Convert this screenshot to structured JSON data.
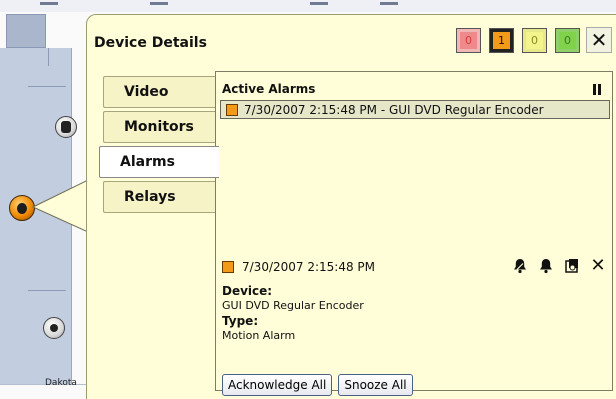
{
  "map": {
    "label": "Dakota"
  },
  "panel": {
    "title": "Device Details",
    "status_counts": [
      {
        "name": "red",
        "value": "0",
        "outer": "#f0b7b7",
        "inner": "#f08a8a",
        "text": "#d04040"
      },
      {
        "name": "orange",
        "value": "1",
        "outer": "#222222",
        "inner": "#f39a18",
        "text": "#111111"
      },
      {
        "name": "yellow",
        "value": "0",
        "outer": "#e6e88a",
        "inner": "#f3f58a",
        "text": "#8a8a20"
      },
      {
        "name": "green",
        "value": "0",
        "outer": "#8fd06a",
        "inner": "#7fd24a",
        "text": "#3a7a20"
      }
    ],
    "close_label": "✕"
  },
  "tabs": [
    {
      "label": "Video",
      "active": false
    },
    {
      "label": "Monitors",
      "active": false
    },
    {
      "label": "Alarms",
      "active": true
    },
    {
      "label": "Relays",
      "active": false
    }
  ],
  "alarms": {
    "header": "Active Alarms",
    "list": [
      {
        "text": "7/30/2007 2:15:48 PM - GUI DVD Regular Encoder",
        "color": "#f39a18"
      }
    ],
    "detail": {
      "timestamp": "7/30/2007 2:15:48 PM",
      "device_label": "Device:",
      "device_value": "GUI DVD Regular Encoder",
      "type_label": "Type:",
      "type_value": "Motion Alarm"
    },
    "acknowledge_all": "Acknowledge All",
    "snooze_all": "Snooze All"
  }
}
